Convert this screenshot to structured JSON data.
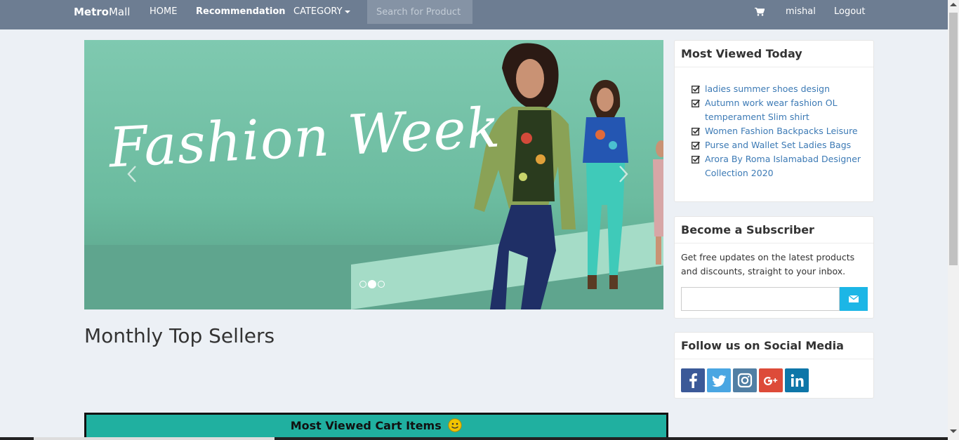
{
  "navbar": {
    "brand_bold": "Metro",
    "brand_rest": "Mall",
    "home": "HOME",
    "recommendation": "Recommendation",
    "category": "CATEGORY",
    "search_placeholder": "Search for Product",
    "user": "mishal",
    "logout": "Logout",
    "cart_icon": "shopping-cart-icon"
  },
  "carousel": {
    "heading": "Fashion Week",
    "active_slide_index": 1,
    "slide_count": 3
  },
  "main": {
    "monthly_title": "Monthly Top Sellers",
    "cart_bar_title": "Most Viewed Cart Items",
    "cart_bar_color": "#20b0a0"
  },
  "sidebar": {
    "most_viewed": {
      "title": "Most Viewed Today",
      "items": [
        "ladies summer shoes design",
        "Autumn work wear fashion OL temperament Slim shirt",
        "Women Fashion Backpacks Leisure",
        "Purse and Wallet Set Ladies Bags",
        "Arora By Roma Islamabad Designer Collection 2020"
      ]
    },
    "subscriber": {
      "title": "Become a Subscriber",
      "text": "Get free updates on the latest products and discounts, straight to your inbox."
    },
    "social": {
      "title": "Follow us on Social Media",
      "networks": [
        "facebook",
        "twitter",
        "instagram",
        "google-plus",
        "linkedin"
      ]
    }
  },
  "colors": {
    "navbar": "#6d7d92",
    "page_bg": "#ecf0f5",
    "link": "#3c7ab5",
    "subscribe_button": "#1cb6e6"
  }
}
